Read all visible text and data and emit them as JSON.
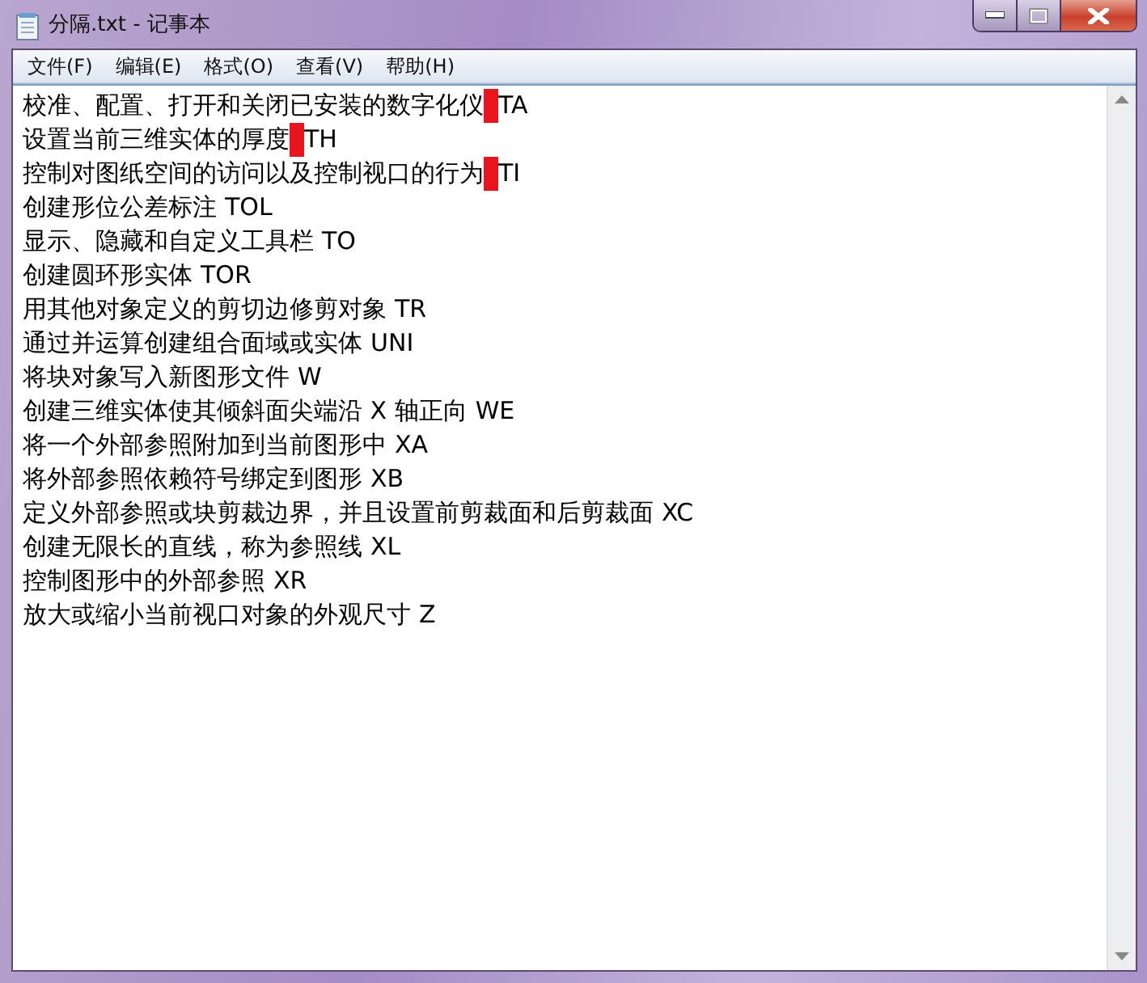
{
  "window": {
    "title": "分隔.txt - 记事本"
  },
  "menu": [
    "文件(F)",
    "编辑(E)",
    "格式(O)",
    "查看(V)",
    "帮助(H)"
  ],
  "lines": [
    {
      "text": "校准、配置、打开和关闭已安装的数字化仪",
      "code": "TA",
      "marked": true
    },
    {
      "text": "设置当前三维实体的厚度",
      "code": "TH",
      "marked": true
    },
    {
      "text": "控制对图纸空间的访问以及控制视口的行为",
      "code": "TI",
      "marked": true
    },
    {
      "text": "创建形位公差标注",
      "code": "TOL",
      "marked": false
    },
    {
      "text": "显示、隐藏和自定义工具栏",
      "code": "TO",
      "marked": false
    },
    {
      "text": "创建圆环形实体",
      "code": "TOR",
      "marked": false
    },
    {
      "text": "用其他对象定义的剪切边修剪对象",
      "code": "TR",
      "marked": false
    },
    {
      "text": "通过并运算创建组合面域或实体",
      "code": "UNI",
      "marked": false
    },
    {
      "text": "将块对象写入新图形文件",
      "code": "W",
      "marked": false
    },
    {
      "text": "创建三维实体使其倾斜面尖端沿 X 轴正向",
      "code": "WE",
      "marked": false
    },
    {
      "text": "将一个外部参照附加到当前图形中",
      "code": "XA",
      "marked": false
    },
    {
      "text": "将外部参照依赖符号绑定到图形",
      "code": "XB",
      "marked": false
    },
    {
      "text": "定义外部参照或块剪裁边界，并且设置前剪裁面和后剪裁面",
      "code": "XC",
      "marked": false
    },
    {
      "text": "创建无限长的直线，称为参照线",
      "code": "XL",
      "marked": false
    },
    {
      "text": "控制图形中的外部参照",
      "code": "XR",
      "marked": false
    },
    {
      "text": "放大或缩小当前视口对象的外观尺寸",
      "code": "Z",
      "marked": false
    }
  ]
}
